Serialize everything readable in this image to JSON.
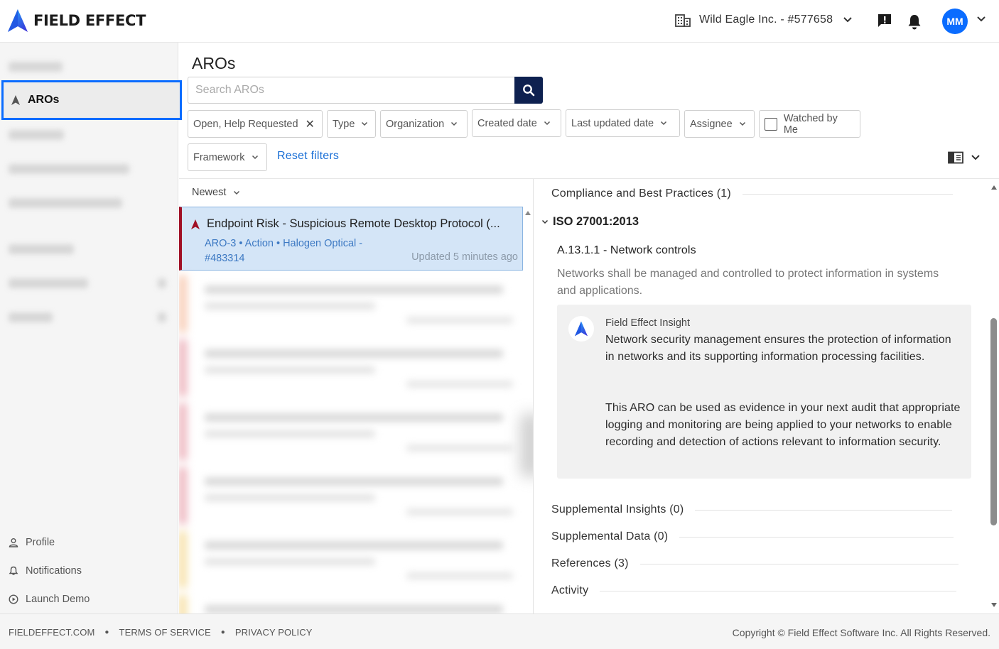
{
  "header": {
    "brand": "FIELD EFFECT",
    "org_name": "Wild Eagle Inc. - #577658",
    "avatar_initials": "MM",
    "colors": {
      "accent": "#0a6cff",
      "brand_dark": "#0e2150",
      "alert_red": "#a01026"
    }
  },
  "sidebar": {
    "active_item": "AROs",
    "bottom_items": [
      {
        "label": "Profile",
        "icon": "user-icon"
      },
      {
        "label": "Notifications",
        "icon": "bell-icon"
      },
      {
        "label": "Launch Demo",
        "icon": "play-circle-icon"
      }
    ]
  },
  "main": {
    "title": "AROs",
    "search_placeholder": "Search AROs",
    "filters": {
      "status": "Open, Help Requested",
      "type": "Type",
      "organization": "Organization",
      "created_date": "Created date",
      "last_updated_date": "Last updated date",
      "assignee": "Assignee",
      "watched": "Watched by Me",
      "framework": "Framework",
      "reset": "Reset filters"
    },
    "sort": "Newest",
    "selected_aro": {
      "title": "Endpoint Risk - Suspicious Remote Desktop Protocol (...",
      "meta_line1": "ARO-3 • Action • Halogen Optical -",
      "meta_line2": "#483314",
      "updated": "Updated 5 minutes ago"
    }
  },
  "detail": {
    "compliance_heading": "Compliance and Best Practices (1)",
    "framework": "ISO 27001:2013",
    "control_title": "A.13.1.1 - Network controls",
    "control_desc": "Networks shall be managed and controlled to protect information in systems and applications.",
    "insight": {
      "source": "Field Effect Insight",
      "p1": "Network security management ensures the protection of information in networks and its supporting information processing facilities.",
      "p2": "This ARO can be used as evidence in your next audit that appropriate logging and monitoring are being applied to your networks to enable recording and detection of actions relevant to information security."
    },
    "sections": {
      "supplemental_insights": "Supplemental Insights (0)",
      "supplemental_data": "Supplemental Data (0)",
      "references": "References (3)",
      "activity": "Activity"
    }
  },
  "footer": {
    "link1": "FIELDEFFECT.COM",
    "link2": "TERMS OF SERVICE",
    "link3": "PRIVACY POLICY",
    "copyright": "Copyright © Field Effect Software Inc. All Rights Reserved."
  }
}
